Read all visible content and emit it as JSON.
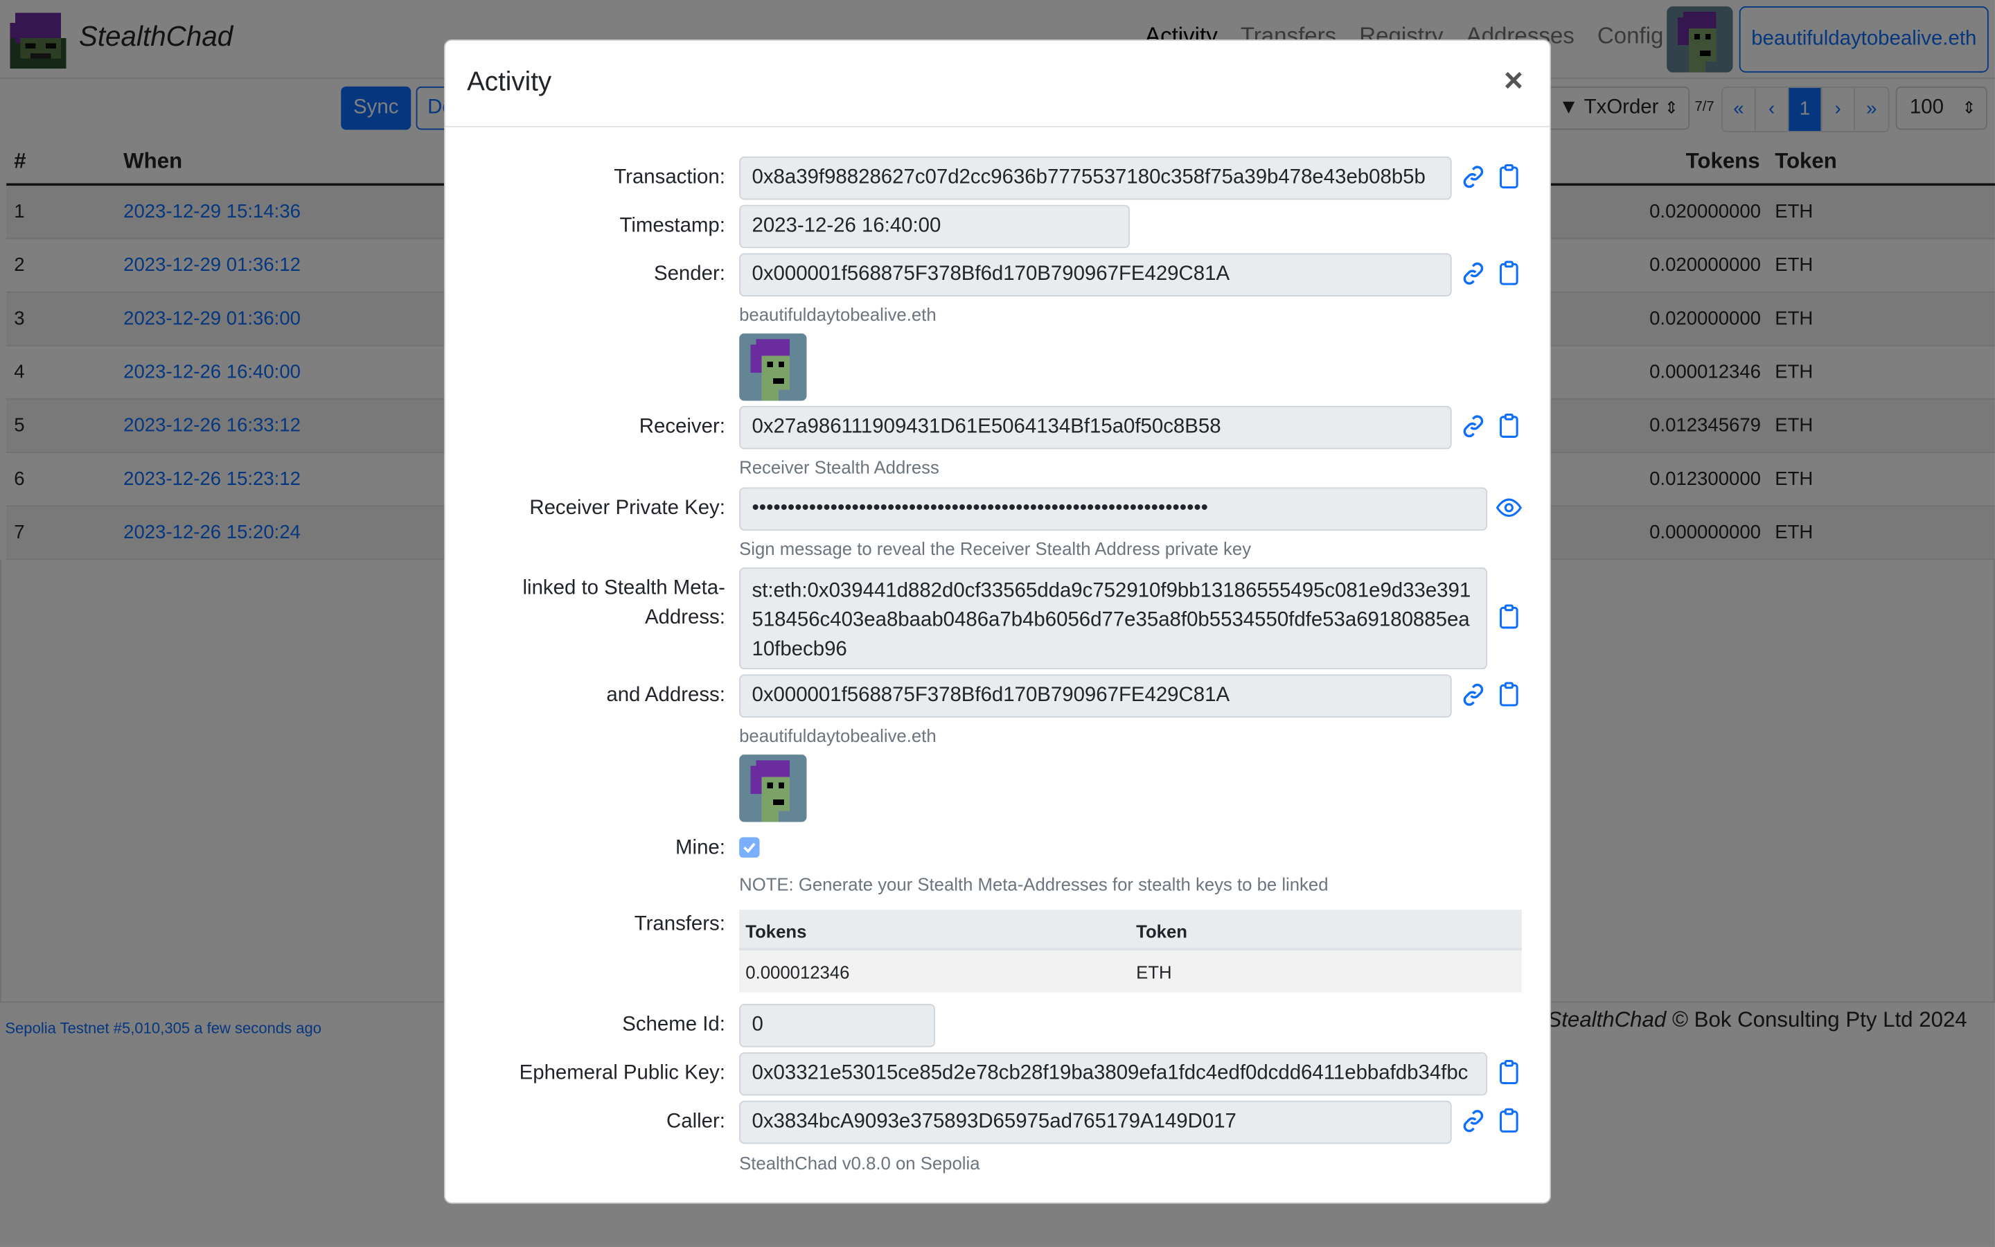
{
  "app": {
    "brand": "StealthChad",
    "nav": [
      "Activity",
      "Transfers",
      "Registry",
      "Addresses",
      "Config"
    ],
    "account_label": "beautifuldaytobealive.eth",
    "buttons": {
      "sync": "Sync",
      "partial": "De"
    },
    "sort_select": "▼ TxOrder",
    "page_count": "7/7",
    "pager": [
      "«",
      "‹",
      "1",
      "›",
      "»"
    ],
    "page_size": "100"
  },
  "table": {
    "headers": {
      "num": "#",
      "when": "When",
      "tokens": "Tokens",
      "token": "Token"
    },
    "rows": [
      {
        "num": "1",
        "when": "2023-12-29 15:14:36",
        "tokens": "0.020000000",
        "token": "ETH"
      },
      {
        "num": "2",
        "when": "2023-12-29 01:36:12",
        "tokens": "0.020000000",
        "token": "ETH"
      },
      {
        "num": "3",
        "when": "2023-12-29 01:36:00",
        "tokens": "0.020000000",
        "token": "ETH"
      },
      {
        "num": "4",
        "when": "2023-12-26 16:40:00",
        "tokens": "0.000012346",
        "token": "ETH"
      },
      {
        "num": "5",
        "when": "2023-12-26 16:33:12",
        "tokens": "0.012345679",
        "token": "ETH"
      },
      {
        "num": "6",
        "when": "2023-12-26 15:23:12",
        "tokens": "0.012300000",
        "token": "ETH"
      },
      {
        "num": "7",
        "when": "2023-12-26 15:20:24",
        "tokens": "0.000000000",
        "token": "ETH"
      }
    ]
  },
  "footer": {
    "network": "Sepolia Testnet #5,010,305 a few seconds ago",
    "brand": "StealthChad",
    "copyright": " © Bok Consulting Pty Ltd 2024"
  },
  "modal": {
    "title": "Activity",
    "close": "×",
    "labels": {
      "transaction": "Transaction:",
      "timestamp": "Timestamp:",
      "sender": "Sender:",
      "receiver": "Receiver:",
      "receiver_pk": "Receiver Private Key:",
      "linked_meta": "linked to Stealth Meta-Address:",
      "and_address": "and Address:",
      "mine": "Mine:",
      "transfers": "Transfers:",
      "scheme_id": "Scheme Id:",
      "ephemeral": "Ephemeral Public Key:",
      "caller": "Caller:"
    },
    "values": {
      "transaction": "0x8a39f98828627c07d2cc9636b7775537180c358f75a39b478e43eb08b5b",
      "timestamp": "2023-12-26 16:40:00",
      "sender": "0x000001f568875F378Bf6d170B790967FE429C81A",
      "sender_ens": "beautifuldaytobealive.eth",
      "receiver": "0x27a986111909431D61E5064134Bf15a0f50c8B58",
      "receiver_hint": "Receiver Stealth Address",
      "receiver_pk": "••••••••••••••••••••••••••••••••••••••••••••••••••••••••••••••••",
      "receiver_pk_hint": "Sign message to reveal the Receiver Stealth Address private key",
      "meta_address": "st:eth:0x039441d882d0cf33565dda9c752910f9bb13186555495c081e9d33e391518456c403ea8baab0486a7b4b6056d77e35a8f0b5534550fdfe53a69180885ea10fbecb96",
      "and_address": "0x000001f568875F378Bf6d170B790967FE429C81A",
      "and_address_ens": "beautifuldaytobealive.eth",
      "mine_note": "NOTE: Generate your Stealth Meta-Addresses for stealth keys to be linked",
      "scheme_id": "0",
      "ephemeral": "0x03321e53015ce85d2e78cb28f19ba3809efa1fdc4edf0dcdd6411ebbafdb34fbc",
      "caller": "0x3834bcA9093e375893D65975ad765179A149D017",
      "version": "StealthChad v0.8.0 on Sepolia"
    },
    "transfers": {
      "headers": {
        "tokens": "Tokens",
        "token": "Token"
      },
      "rows": [
        {
          "tokens": "0.000012346",
          "token": "ETH"
        }
      ]
    },
    "mine_checked": true
  },
  "colors": {
    "primary": "#0d6efd",
    "backdrop": "#7f7f7f",
    "field_bg": "#e9ecef",
    "avatar_bg": "#638596",
    "punk_hair": "#6a2c9e",
    "punk_skin": "#7da269"
  }
}
